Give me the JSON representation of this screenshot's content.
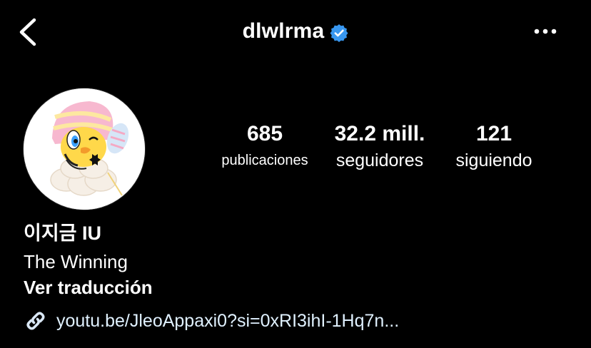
{
  "header": {
    "username": "dlwlrma",
    "back_icon": "chevron-left-icon",
    "verified_icon": "verified-badge-icon",
    "more_icon": "more-horizontal-icon"
  },
  "profile": {
    "avatar": "profile-picture",
    "stats": {
      "posts": {
        "value": "685",
        "label": "publicaciones"
      },
      "followers": {
        "value": "32.2 mill.",
        "label": "seguidores"
      },
      "following": {
        "value": "121",
        "label": "siguiendo"
      }
    },
    "display_name": "이지금 IU",
    "bio": "The Winning",
    "translate_label": "Ver traducción",
    "link": {
      "icon": "link-icon",
      "text": "youtu.be/JleoAppaxi0?si=0xRI3ihI-1Hq7n..."
    }
  },
  "colors": {
    "background": "#000000",
    "text": "#ffffff",
    "verified": "#3897f0",
    "link": "#e0f1ff"
  }
}
